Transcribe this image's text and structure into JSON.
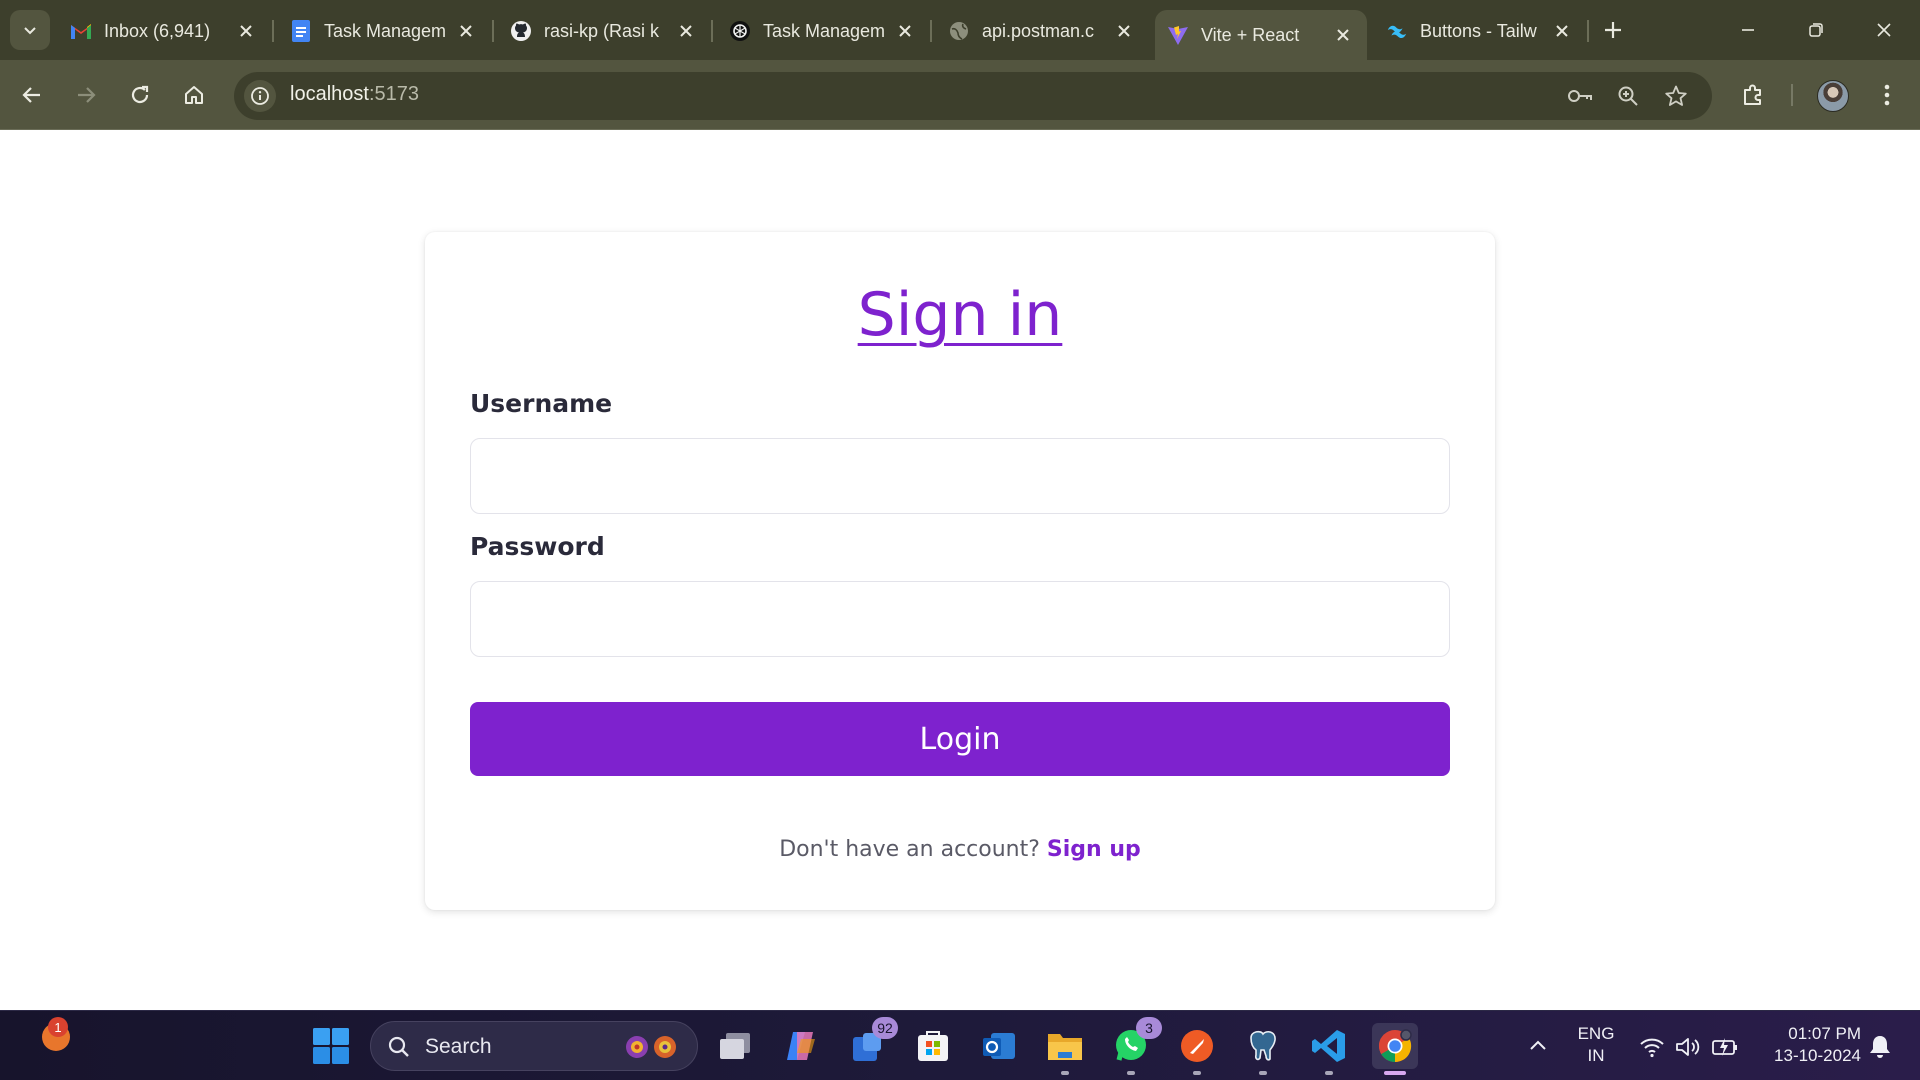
{
  "browser": {
    "tabs": [
      {
        "title": "Inbox (6,941)",
        "favicon": "gmail-icon",
        "active": false
      },
      {
        "title": "Task Managem",
        "favicon": "docs-icon",
        "active": false
      },
      {
        "title": "rasi-kp (Rasi k",
        "favicon": "github-icon",
        "active": false
      },
      {
        "title": "Task Managem",
        "favicon": "chatgpt-icon",
        "active": false
      },
      {
        "title": "api.postman.c",
        "favicon": "globe-icon",
        "active": false
      },
      {
        "title": "Vite + React",
        "favicon": "vite-icon",
        "active": true
      },
      {
        "title": "Buttons - Tailw",
        "favicon": "tailwind-icon",
        "active": false
      }
    ],
    "address": {
      "host": "localhost",
      "port": ":5173"
    }
  },
  "page": {
    "title": "Sign in",
    "username_label": "Username",
    "username_value": "",
    "password_label": "Password",
    "password_value": "",
    "login_label": "Login",
    "signup_prompt": "Don't have an account?",
    "signup_link": "Sign up"
  },
  "taskbar": {
    "weather_badge": "1",
    "search_placeholder": "Search",
    "apps": [
      {
        "name": "task-view",
        "badge": ""
      },
      {
        "name": "copilot",
        "badge": ""
      },
      {
        "name": "teams",
        "badge": "92"
      },
      {
        "name": "microsoft-store",
        "badge": ""
      },
      {
        "name": "outlook",
        "badge": ""
      },
      {
        "name": "file-explorer",
        "badge": ""
      },
      {
        "name": "whatsapp",
        "badge": "3"
      },
      {
        "name": "postman",
        "badge": ""
      },
      {
        "name": "pgadmin",
        "badge": ""
      },
      {
        "name": "vscode",
        "badge": ""
      },
      {
        "name": "chrome",
        "badge": ""
      }
    ],
    "tray": {
      "lang_line1": "ENG",
      "lang_line2": "IN",
      "time": "01:07 PM",
      "date": "13-10-2024"
    }
  },
  "colors": {
    "accent": "#7e22ce",
    "browser_frame": "#3d3f2c",
    "toolbar": "#53553f",
    "taskbar": "#1e1a3a"
  }
}
